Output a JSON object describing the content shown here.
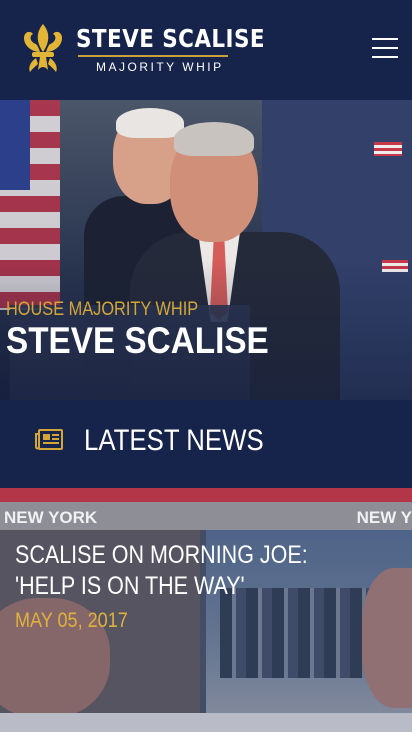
{
  "header": {
    "brand_name": "STEVE SCALISE",
    "brand_subtitle": "MAJORITY WHIP",
    "menu_icon": "hamburger-menu-icon",
    "logo_icon": "fleur-de-lis-icon"
  },
  "hero": {
    "kicker": "HOUSE MAJORITY WHIP",
    "title": "STEVE SCALISE"
  },
  "latest_news": {
    "icon": "newspaper-icon",
    "heading": "LATEST NEWS"
  },
  "news_items": [
    {
      "title": "SCALISE ON MORNING JOE: 'HELP IS ON THE WAY'",
      "date": "MAY 05, 2017",
      "image_text_left": "NEW YORK",
      "image_text_right": "NEW Y"
    }
  ],
  "colors": {
    "navy": "#16234a",
    "gold": "#d4a636",
    "white": "#ffffff"
  }
}
